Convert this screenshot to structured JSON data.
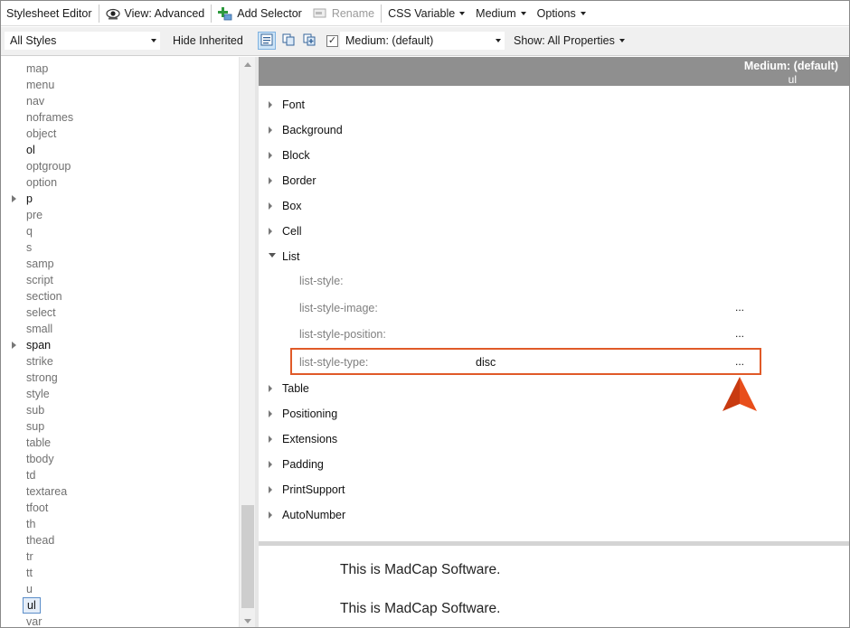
{
  "toolbar": {
    "title": "Stylesheet Editor",
    "view": "View: Advanced",
    "add_selector": "Add Selector",
    "rename": "Rename",
    "css_variable": "CSS Variable",
    "medium": "Medium",
    "options": "Options"
  },
  "filterbar": {
    "styles_dropdown": "All Styles",
    "hide_inherited": "Hide Inherited",
    "medium_checked": true,
    "medium_dropdown": "Medium: (default)",
    "show_properties": "Show: All Properties"
  },
  "tree": {
    "items": [
      {
        "label": "map",
        "expandable": false,
        "dark": false
      },
      {
        "label": "menu",
        "expandable": false,
        "dark": false
      },
      {
        "label": "nav",
        "expandable": false,
        "dark": false
      },
      {
        "label": "noframes",
        "expandable": false,
        "dark": false
      },
      {
        "label": "object",
        "expandable": false,
        "dark": false
      },
      {
        "label": "ol",
        "expandable": false,
        "dark": true
      },
      {
        "label": "optgroup",
        "expandable": false,
        "dark": false
      },
      {
        "label": "option",
        "expandable": false,
        "dark": false
      },
      {
        "label": "p",
        "expandable": true,
        "dark": true
      },
      {
        "label": "pre",
        "expandable": false,
        "dark": false
      },
      {
        "label": "q",
        "expandable": false,
        "dark": false
      },
      {
        "label": "s",
        "expandable": false,
        "dark": false
      },
      {
        "label": "samp",
        "expandable": false,
        "dark": false
      },
      {
        "label": "script",
        "expandable": false,
        "dark": false
      },
      {
        "label": "section",
        "expandable": false,
        "dark": false
      },
      {
        "label": "select",
        "expandable": false,
        "dark": false
      },
      {
        "label": "small",
        "expandable": false,
        "dark": false
      },
      {
        "label": "span",
        "expandable": true,
        "dark": true
      },
      {
        "label": "strike",
        "expandable": false,
        "dark": false
      },
      {
        "label": "strong",
        "expandable": false,
        "dark": false
      },
      {
        "label": "style",
        "expandable": false,
        "dark": false
      },
      {
        "label": "sub",
        "expandable": false,
        "dark": false
      },
      {
        "label": "sup",
        "expandable": false,
        "dark": false
      },
      {
        "label": "table",
        "expandable": false,
        "dark": false
      },
      {
        "label": "tbody",
        "expandable": false,
        "dark": false
      },
      {
        "label": "td",
        "expandable": false,
        "dark": false
      },
      {
        "label": "textarea",
        "expandable": false,
        "dark": false
      },
      {
        "label": "tfoot",
        "expandable": false,
        "dark": false
      },
      {
        "label": "th",
        "expandable": false,
        "dark": false
      },
      {
        "label": "thead",
        "expandable": false,
        "dark": false
      },
      {
        "label": "tr",
        "expandable": false,
        "dark": false
      },
      {
        "label": "tt",
        "expandable": false,
        "dark": false
      },
      {
        "label": "u",
        "expandable": false,
        "dark": false
      },
      {
        "label": "ul",
        "expandable": false,
        "dark": true,
        "selected": true
      },
      {
        "label": "var",
        "expandable": false,
        "dark": false
      }
    ]
  },
  "properties": {
    "header_medium": "Medium: (default)",
    "header_selector": "ul",
    "groups_before": [
      "Font",
      "Background",
      "Block",
      "Border",
      "Box",
      "Cell"
    ],
    "open_group": "List",
    "list_props": [
      {
        "name": "list-style:",
        "value": "",
        "has_button": false
      },
      {
        "name": "list-style-image:",
        "value": "",
        "has_button": true
      },
      {
        "name": "list-style-position:",
        "value": "",
        "has_button": true
      },
      {
        "name": "list-style-type:",
        "value": "disc",
        "has_button": true,
        "highlighted": true
      }
    ],
    "ellipsis": "...",
    "groups_after": [
      "Table",
      "Positioning",
      "Extensions",
      "Padding",
      "PrintSupport",
      "AutoNumber"
    ]
  },
  "preview": {
    "lines": [
      "This is MadCap Software.",
      "This is MadCap Software."
    ]
  },
  "colors": {
    "highlight_border": "#e05a28",
    "pointer": "#e84e1b"
  }
}
